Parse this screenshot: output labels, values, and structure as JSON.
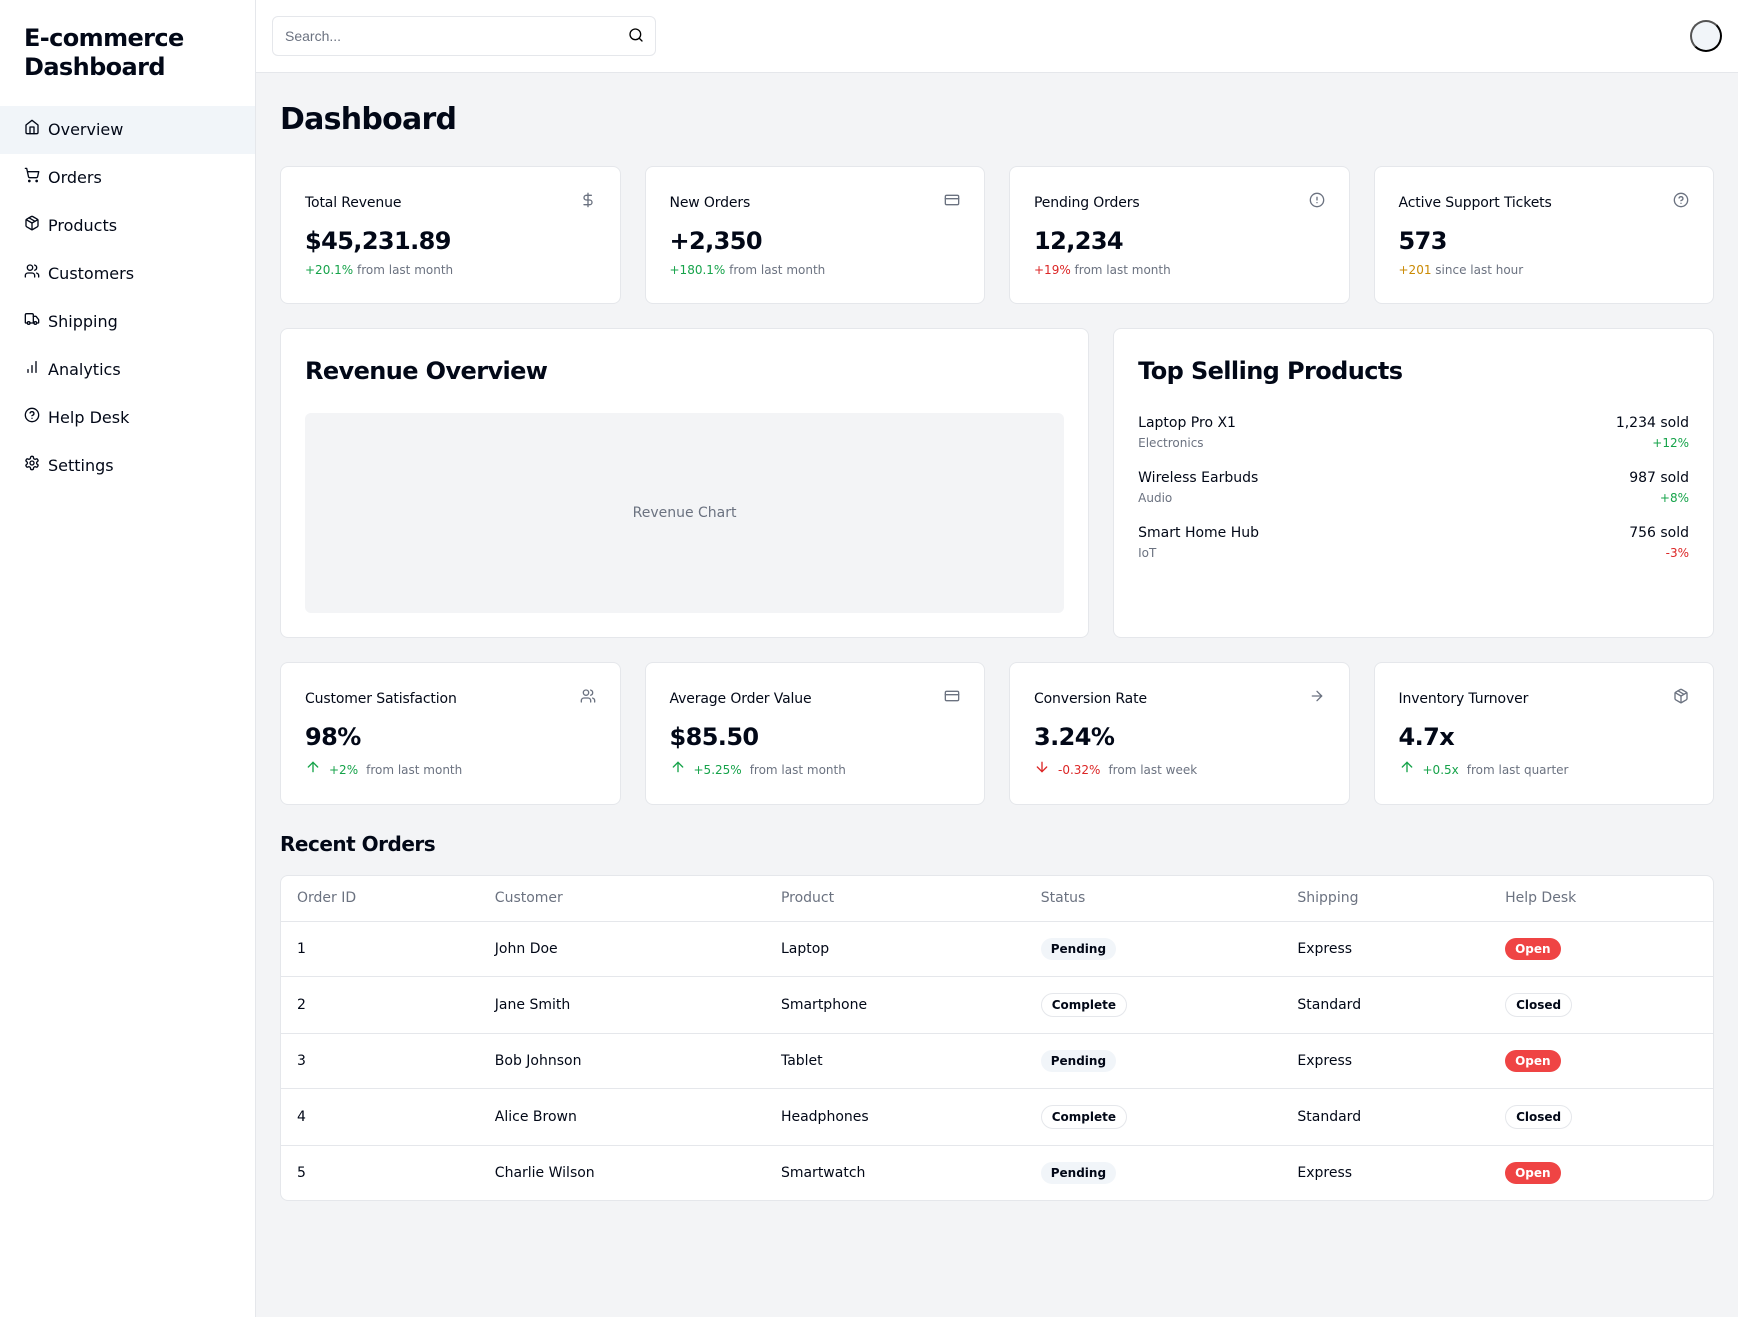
{
  "brand": "E-commerce Dashboard",
  "search": {
    "placeholder": "Search..."
  },
  "nav": [
    {
      "label": "Overview",
      "icon": "home",
      "active": true
    },
    {
      "label": "Orders",
      "icon": "cart",
      "active": false
    },
    {
      "label": "Products",
      "icon": "package",
      "active": false
    },
    {
      "label": "Customers",
      "icon": "users",
      "active": false
    },
    {
      "label": "Shipping",
      "icon": "truck",
      "active": false
    },
    {
      "label": "Analytics",
      "icon": "bar-chart",
      "active": false
    },
    {
      "label": "Help Desk",
      "icon": "help",
      "active": false
    },
    {
      "label": "Settings",
      "icon": "settings",
      "active": false
    }
  ],
  "page_title": "Dashboard",
  "stats_top": [
    {
      "title": "Total Revenue",
      "icon": "dollar",
      "value": "$45,231.89",
      "change": "+20.1%",
      "change_color": "green",
      "suffix": " from last month"
    },
    {
      "title": "New Orders",
      "icon": "credit-card",
      "value": "+2,350",
      "change": "+180.1%",
      "change_color": "green",
      "suffix": " from last month"
    },
    {
      "title": "Pending Orders",
      "icon": "alert",
      "value": "12,234",
      "change": "+19%",
      "change_color": "red",
      "suffix": " from last month"
    },
    {
      "title": "Active Support Tickets",
      "icon": "help",
      "value": "573",
      "change": "+201",
      "change_color": "yellow",
      "suffix": " since last hour"
    }
  ],
  "revenue_title": "Revenue Overview",
  "revenue_placeholder": "Revenue Chart",
  "top_products_title": "Top Selling Products",
  "top_products": [
    {
      "name": "Laptop Pro X1",
      "category": "Electronics",
      "sold": "1,234 sold",
      "change": "+12%",
      "change_color": "green"
    },
    {
      "name": "Wireless Earbuds",
      "category": "Audio",
      "sold": "987 sold",
      "change": "+8%",
      "change_color": "green"
    },
    {
      "name": "Smart Home Hub",
      "category": "IoT",
      "sold": "756 sold",
      "change": "-3%",
      "change_color": "red"
    }
  ],
  "stats_bottom": [
    {
      "title": "Customer Satisfaction",
      "icon": "users",
      "value": "98%",
      "change": "+2%",
      "change_dir": "up",
      "change_color": "green",
      "suffix": "from last month"
    },
    {
      "title": "Average Order Value",
      "icon": "credit-card",
      "value": "$85.50",
      "change": "+5.25%",
      "change_dir": "up",
      "change_color": "green",
      "suffix": "from last month"
    },
    {
      "title": "Conversion Rate",
      "icon": "arrow-right",
      "value": "3.24%",
      "change": "-0.32%",
      "change_dir": "down",
      "change_color": "red",
      "suffix": "from last week"
    },
    {
      "title": "Inventory Turnover",
      "icon": "package",
      "value": "4.7x",
      "change": "+0.5x",
      "change_dir": "up",
      "change_color": "green",
      "suffix": "from last quarter"
    }
  ],
  "recent_orders_title": "Recent Orders",
  "orders_columns": [
    "Order ID",
    "Customer",
    "Product",
    "Status",
    "Shipping",
    "Help Desk"
  ],
  "orders": [
    {
      "id": "1",
      "customer": "John Doe",
      "product": "Laptop",
      "status": "Pending",
      "status_variant": "secondary",
      "shipping": "Express",
      "helpdesk": "Open",
      "helpdesk_variant": "destructive"
    },
    {
      "id": "2",
      "customer": "Jane Smith",
      "product": "Smartphone",
      "status": "Complete",
      "status_variant": "outline",
      "shipping": "Standard",
      "helpdesk": "Closed",
      "helpdesk_variant": "outline"
    },
    {
      "id": "3",
      "customer": "Bob Johnson",
      "product": "Tablet",
      "status": "Pending",
      "status_variant": "secondary",
      "shipping": "Express",
      "helpdesk": "Open",
      "helpdesk_variant": "destructive"
    },
    {
      "id": "4",
      "customer": "Alice Brown",
      "product": "Headphones",
      "status": "Complete",
      "status_variant": "outline",
      "shipping": "Standard",
      "helpdesk": "Closed",
      "helpdesk_variant": "outline"
    },
    {
      "id": "5",
      "customer": "Charlie Wilson",
      "product": "Smartwatch",
      "status": "Pending",
      "status_variant": "secondary",
      "shipping": "Express",
      "helpdesk": "Open",
      "helpdesk_variant": "destructive"
    }
  ]
}
